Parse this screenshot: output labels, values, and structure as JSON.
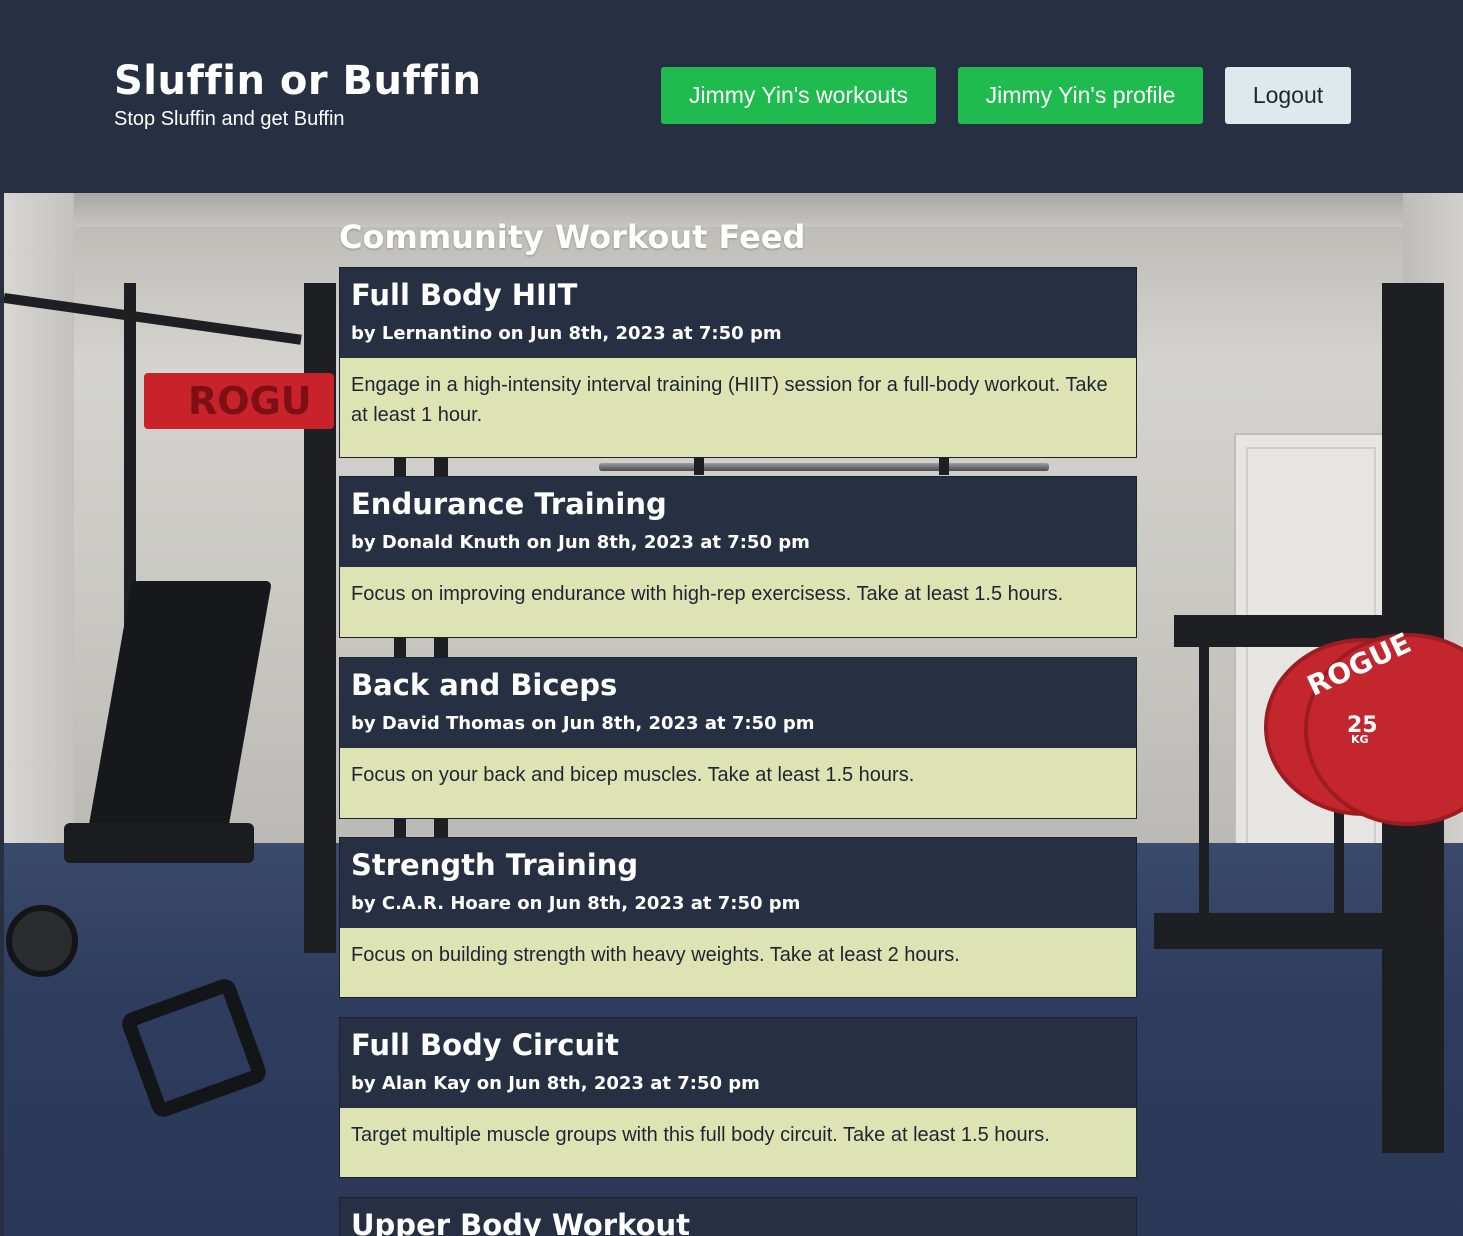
{
  "header": {
    "title": "Sluffin or Buffin",
    "subtitle": "Stop Sluffin and get Buffin",
    "nav": {
      "workouts_label": "Jimmy Yin's workouts",
      "profile_label": "Jimmy Yin's profile",
      "logout_label": "Logout"
    }
  },
  "background": {
    "sign_text": "ROGU",
    "plate_brand": "ROGUE",
    "plate_weight": "25",
    "plate_unit": "KG"
  },
  "feed": {
    "title": "Community Workout Feed",
    "workouts": [
      {
        "title": "Full Body HIIT",
        "meta": "by Lernantino on Jun 8th, 2023 at 7:50 pm",
        "description": "Engage in a high-intensity interval training (HIIT) session for a full-body workout. Take at least 1 hour."
      },
      {
        "title": "Endurance Training",
        "meta": "by Donald Knuth on Jun 8th, 2023 at 7:50 pm",
        "description": "Focus on improving endurance with high-rep exercisess. Take at least 1.5 hours."
      },
      {
        "title": "Back and Biceps",
        "meta": "by David Thomas on Jun 8th, 2023 at 7:50 pm",
        "description": "Focus on your back and bicep muscles. Take at least 1.5 hours."
      },
      {
        "title": "Strength Training",
        "meta": "by C.A.R. Hoare on Jun 8th, 2023 at 7:50 pm",
        "description": "Focus on building strength with heavy weights. Take at least 2 hours."
      },
      {
        "title": "Full Body Circuit",
        "meta": "by Alan Kay on Jun 8th, 2023 at 7:50 pm",
        "description": "Target multiple muscle groups with this full body circuit. Take at least 1.5 hours."
      },
      {
        "title": "Upper Body Workout",
        "meta": "",
        "description": ""
      }
    ]
  }
}
